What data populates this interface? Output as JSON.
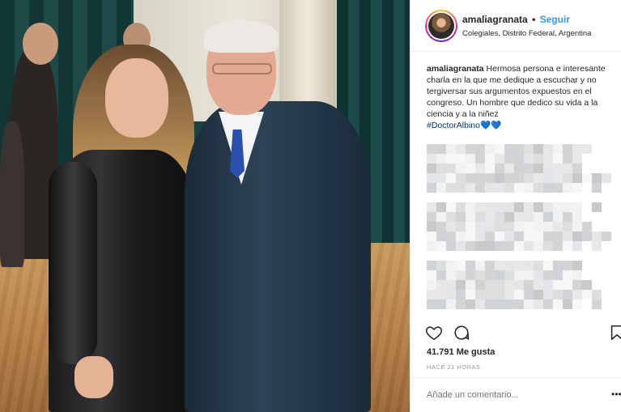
{
  "post": {
    "username": "amaliagranata",
    "separator": "•",
    "follow_label": "Seguir",
    "location": "Colegiales, Distrito Federal, Argentina",
    "caption_user": "amaliagranata",
    "caption_text": "Hermosa persona e interesante charla en la que me dedique a escuchar y no tergiversar sus argumentos expuestos en el congreso. Un hombre que dedico su vida a la ciencia y a la niñez",
    "hashtag": "#DoctorAlbino",
    "hearts": "💙💙",
    "likes": "41.791 Me gusta",
    "timestamp": "HACE 21 HORAS",
    "comment_placeholder": "Añade un comentario...",
    "more_label": "•••"
  },
  "icons": {
    "like": "heart-icon",
    "comment": "comment-icon",
    "save": "bookmark-icon",
    "more": "more-options-icon"
  },
  "colors": {
    "link": "#3897f0",
    "hashtag": "#003569",
    "hearts": "#27c4d1",
    "text": "#262626",
    "muted": "#999999"
  }
}
